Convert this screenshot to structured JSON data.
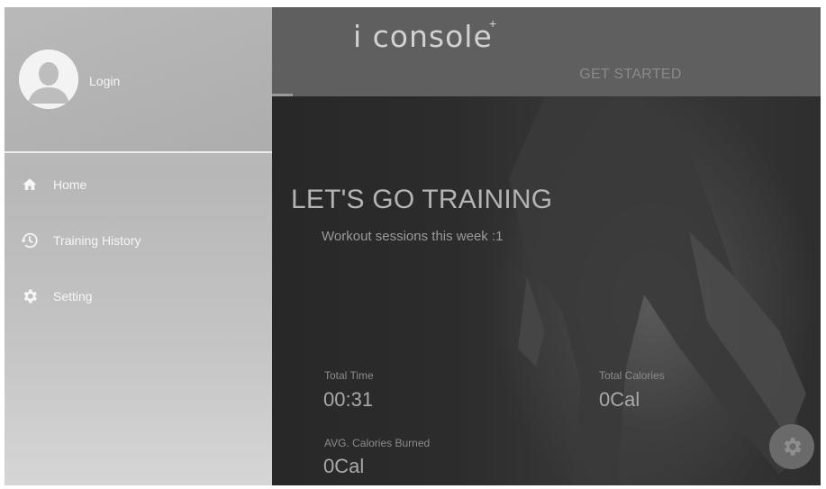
{
  "header": {
    "logo_text": "i console",
    "logo_plus": "+",
    "tab_get_started": "GET STARTED"
  },
  "hero": {
    "title": "LET'S GO TRAINING",
    "subtitle": "Workout sessions this week :1"
  },
  "stats": {
    "total_time_label": "Total Time",
    "total_time_value": "00:31",
    "total_calories_label": "Total Calories",
    "total_calories_value": "0Cal",
    "avg_calories_label": "AVG. Calories Burned",
    "avg_calories_value": "0Cal"
  },
  "drawer": {
    "login_label": "Login",
    "items": [
      {
        "label": "Home",
        "icon": "home-icon"
      },
      {
        "label": "Training History",
        "icon": "history-icon"
      },
      {
        "label": "Setting",
        "icon": "settings-icon"
      }
    ]
  },
  "fab": {
    "icon": "gear-icon"
  }
}
